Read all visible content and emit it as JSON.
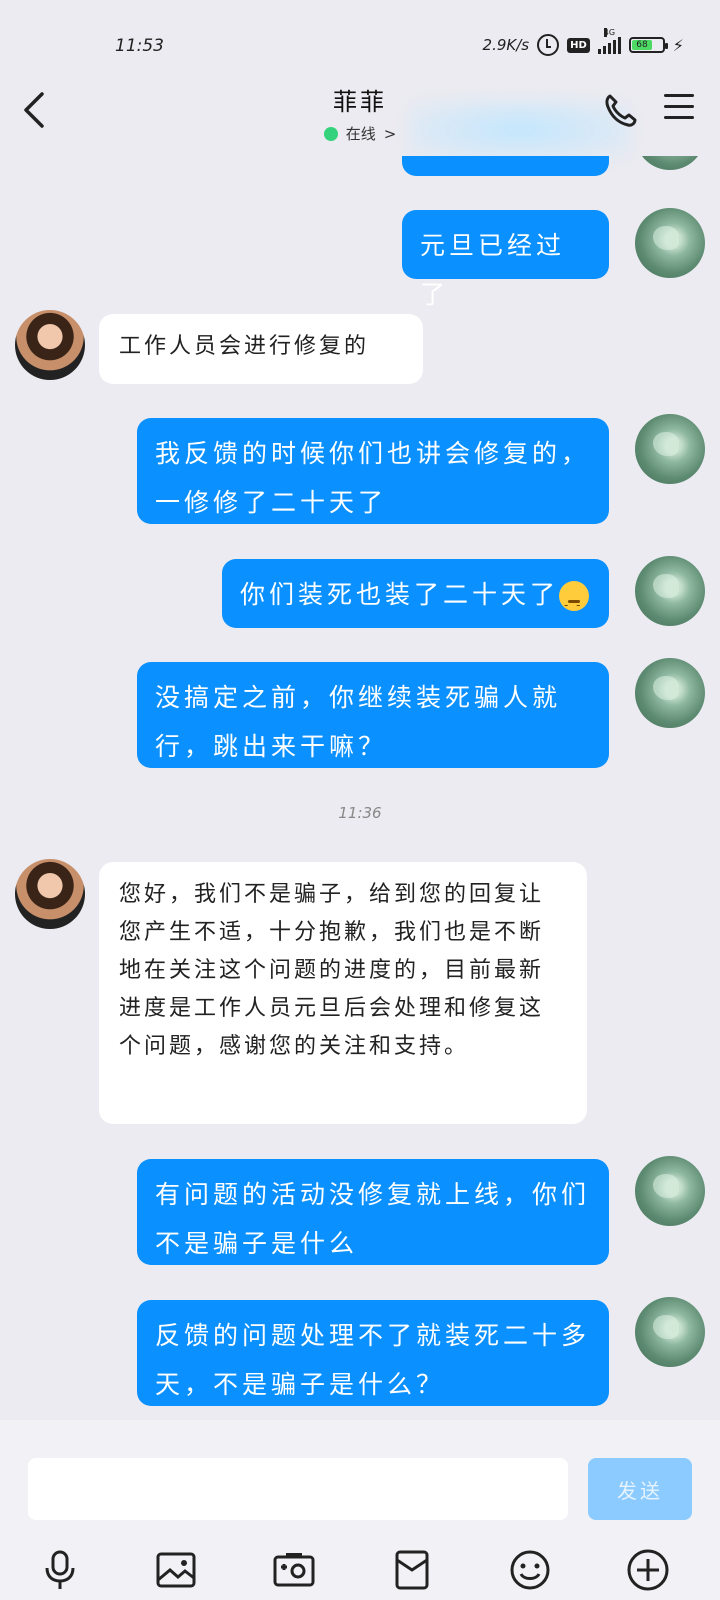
{
  "status_bar": {
    "time": "11:53",
    "speed": "2.9K/s",
    "hd": "HD",
    "network": "4G",
    "battery": "68",
    "battery_level": 0.68
  },
  "header": {
    "title": "菲菲",
    "status": "在线",
    "status_chevron": ">",
    "back_icon": "chevron-left-icon",
    "call_icon": "phone-icon",
    "menu_icon": "hamburger-menu-icon"
  },
  "colors": {
    "my_bubble": "#0a90ff",
    "other_bubble": "#ffffff",
    "background": "#ebebf1",
    "online_dot": "#34d27a",
    "send_button": "#8ccbff"
  },
  "messages": [
    {
      "from": "me",
      "text": ""
    },
    {
      "from": "me",
      "text": "元旦已经过了"
    },
    {
      "from": "other",
      "text": "工作人员会进行修复的"
    },
    {
      "from": "me",
      "text": "我反馈的时候你们也讲会修复的，一修修了二十天了"
    },
    {
      "from": "me",
      "text": "你们装死也装了二十天了",
      "emoji": "unamused-face"
    },
    {
      "from": "me",
      "text": "没搞定之前，你继续装死骗人就行，跳出来干嘛？"
    },
    {
      "from": "system",
      "text": "11:36"
    },
    {
      "from": "other",
      "text": "您好，我们不是骗子，给到您的回复让您产生不适，十分抱歉，我们也是不断地在关注这个问题的进度的，目前最新进度是工作人员元旦后会处理和修复这个问题，感谢您的关注和支持。"
    },
    {
      "from": "me",
      "text": "有问题的活动没修复就上线，你们不是骗子是什么"
    },
    {
      "from": "me",
      "text": "反馈的问题处理不了就装死二十多天，不是骗子是什么？"
    }
  ],
  "input": {
    "value": "",
    "placeholder": "",
    "send_label": "发送"
  },
  "toolbar": {
    "icons": [
      "microphone-icon",
      "image-icon",
      "camera-icon",
      "red-packet-icon",
      "emoji-icon",
      "plus-icon"
    ]
  }
}
